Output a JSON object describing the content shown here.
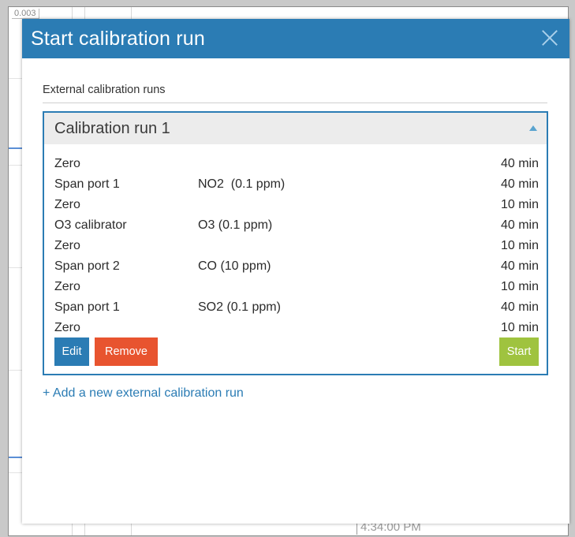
{
  "background": {
    "y_tick": "0.003",
    "x_tick": "4:34:00 PM"
  },
  "dialog": {
    "title": "Start calibration run",
    "section_label": "External calibration runs",
    "run": {
      "title": "Calibration run 1",
      "steps": [
        {
          "name": "Zero",
          "gas": "",
          "duration": "40 min"
        },
        {
          "name": "Span port 1",
          "gas": "NO2  (0.1 ppm)",
          "duration": "40 min"
        },
        {
          "name": "Zero",
          "gas": "",
          "duration": "10 min"
        },
        {
          "name": "O3 calibrator",
          "gas": "O3 (0.1 ppm)",
          "duration": "40 min"
        },
        {
          "name": "Zero",
          "gas": "",
          "duration": "10 min"
        },
        {
          "name": "Span port 2",
          "gas": "CO (10 ppm)",
          "duration": "40 min"
        },
        {
          "name": "Zero",
          "gas": "",
          "duration": "10 min"
        },
        {
          "name": "Span port 1",
          "gas": "SO2 (0.1 ppm)",
          "duration": "40 min"
        },
        {
          "name": "Zero",
          "gas": "",
          "duration": "10 min"
        }
      ],
      "edit_label": "Edit",
      "remove_label": "Remove",
      "start_label": "Start"
    },
    "add_link": "+ Add a new external calibration run"
  },
  "colors": {
    "header": "#2b7cb4",
    "edit": "#2b7cb4",
    "remove": "#e8542f",
    "start": "#9fc33f"
  }
}
